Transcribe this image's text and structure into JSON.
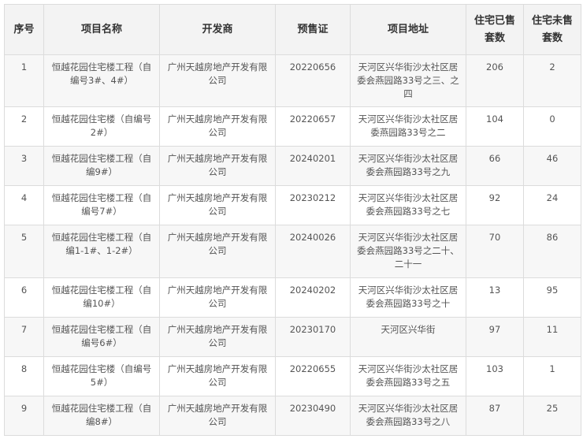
{
  "headers": {
    "index": "序号",
    "name": "项目名称",
    "developer": "开发商",
    "permit": "预售证",
    "address": "项目地址",
    "sold": "住宅已售套数",
    "unsold": "住宅未售套数"
  },
  "rows": [
    {
      "index": "1",
      "name": "恒越花园住宅楼工程（自编号3#、4#）",
      "developer": "广州天越房地产开发有限公司",
      "permit": "20220656",
      "address": "天河区兴华街沙太社区居委会燕园路33号之三、之四",
      "sold": "206",
      "unsold": "2"
    },
    {
      "index": "2",
      "name": "恒越花园住宅楼（自编号2#）",
      "developer": "广州天越房地产开发有限公司",
      "permit": "20220657",
      "address": "天河区兴华街沙太社区居委燕园路33号之二",
      "sold": "104",
      "unsold": "0"
    },
    {
      "index": "3",
      "name": "恒越花园住宅楼工程（自编9#）",
      "developer": "广州天越房地产开发有限公司",
      "permit": "20240201",
      "address": "天河区兴华街沙太社区居委会燕园路33号之九",
      "sold": "66",
      "unsold": "46"
    },
    {
      "index": "4",
      "name": "恒越花园住宅楼工程（自编号7#）",
      "developer": "广州天越房地产开发有限公司",
      "permit": "20230212",
      "address": "天河区兴华街沙太社区居委会燕园路33号之七",
      "sold": "92",
      "unsold": "24"
    },
    {
      "index": "5",
      "name": "恒越花园住宅楼工程（自编1-1#、1-2#）",
      "developer": "广州天越房地产开发有限公司",
      "permit": "20240026",
      "address": "天河区兴华街沙太社区居委会燕园路33号之二十、二十一",
      "sold": "70",
      "unsold": "86"
    },
    {
      "index": "6",
      "name": "恒越花园住宅楼工程（自编10#）",
      "developer": "广州天越房地产开发有限公司",
      "permit": "20240202",
      "address": "天河区兴华街沙太社区居委会燕园路33号之十",
      "sold": "13",
      "unsold": "95"
    },
    {
      "index": "7",
      "name": "恒越花园住宅楼工程（自编号6#）",
      "developer": "广州天越房地产开发有限公司",
      "permit": "20230170",
      "address": "天河区兴华街",
      "sold": "97",
      "unsold": "11"
    },
    {
      "index": "8",
      "name": "恒越花园住宅楼（自编号5#）",
      "developer": "广州天越房地产开发有限公司",
      "permit": "20220655",
      "address": "天河区兴华街沙太社区居委会燕园路33号之五",
      "sold": "103",
      "unsold": "1"
    },
    {
      "index": "9",
      "name": "恒越花园住宅楼工程（自编8#）",
      "developer": "广州天越房地产开发有限公司",
      "permit": "20230490",
      "address": "天河区兴华街沙太社区居委会燕园路33号之八",
      "sold": "87",
      "unsold": "25"
    }
  ]
}
